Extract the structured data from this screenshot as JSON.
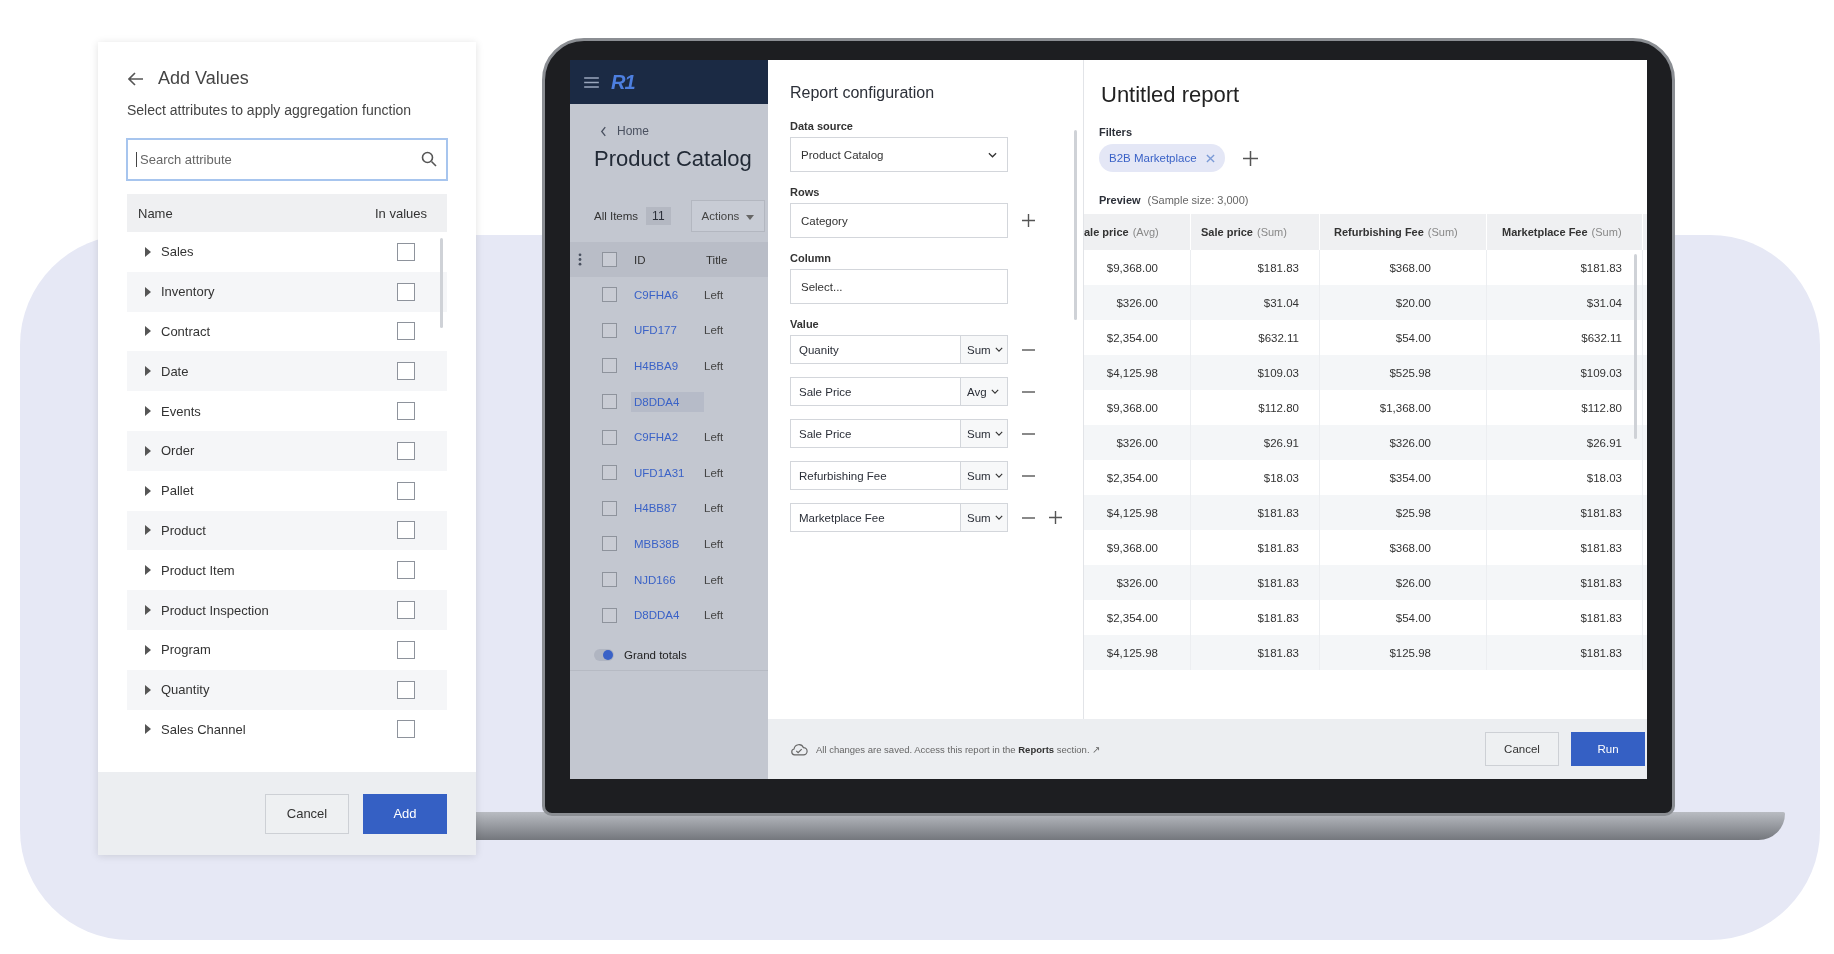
{
  "add_values_panel": {
    "title": "Add Values",
    "subtitle": "Select attributes to apply aggregation function",
    "search": {
      "placeholder": "Search attribute",
      "focused": true
    },
    "columns": [
      "Name",
      "In values"
    ],
    "attributes": [
      {
        "name": "Sales",
        "expanded": false,
        "checked": false
      },
      {
        "name": "Inventory",
        "expanded": false,
        "checked": false
      },
      {
        "name": "Contract",
        "expanded": false,
        "checked": false
      },
      {
        "name": "Date",
        "expanded": false,
        "checked": false
      },
      {
        "name": "Events",
        "expanded": false,
        "checked": false
      },
      {
        "name": "Order",
        "expanded": false,
        "checked": false
      },
      {
        "name": "Pallet",
        "expanded": false,
        "checked": false
      },
      {
        "name": "Product",
        "expanded": false,
        "checked": false
      },
      {
        "name": "Product Item",
        "expanded": false,
        "checked": false
      },
      {
        "name": "Product Inspection",
        "expanded": false,
        "checked": false
      },
      {
        "name": "Program",
        "expanded": false,
        "checked": false
      },
      {
        "name": "Quantity",
        "expanded": false,
        "checked": false
      },
      {
        "name": "Sales Channel",
        "expanded": false,
        "checked": false
      }
    ],
    "buttons": {
      "cancel": "Cancel",
      "add": "Add"
    }
  },
  "app": {
    "logo": "R1",
    "breadcrumb": "Home",
    "page_title": "Product Catalog",
    "view": {
      "label": "All Items",
      "count": "11"
    },
    "actions": "Actions",
    "table": {
      "all_checked": false,
      "columns": [
        "ID",
        "Title"
      ],
      "rows": [
        {
          "id": "C9FHA6",
          "title": "Left",
          "checked": false,
          "selected": false
        },
        {
          "id": "UFD177",
          "title": "Left",
          "checked": false,
          "selected": false
        },
        {
          "id": "H4BBA9",
          "title": "Left",
          "checked": false,
          "selected": false
        },
        {
          "id": "D8DDA4",
          "checked": false,
          "selected": true
        },
        {
          "id": "C9FHA2",
          "title": "Left",
          "checked": false,
          "selected": false
        },
        {
          "id": "UFD1A31",
          "title": "Left",
          "checked": false,
          "selected": false
        },
        {
          "id": "H4BB87",
          "title": "Left",
          "checked": false,
          "selected": false
        },
        {
          "id": "MBB38B",
          "title": "Left",
          "checked": false,
          "selected": false
        },
        {
          "id": "NJD166",
          "title": "Left",
          "checked": false,
          "selected": false
        },
        {
          "id": "D8DDA4",
          "title": "Left",
          "checked": false,
          "selected": false
        }
      ]
    },
    "grand_totals": {
      "label": "Grand totals",
      "on": true
    }
  },
  "report_configuration": {
    "title": "Report configuration",
    "data_source": {
      "label": "Data source",
      "value": "Product Catalog"
    },
    "rows": {
      "label": "Rows",
      "value": "Category"
    },
    "column": {
      "label": "Column",
      "placeholder": "Select..."
    },
    "value": {
      "label": "Value",
      "items": [
        {
          "attribute": "Quanity",
          "aggregation": "Sum",
          "show_add": false
        },
        {
          "attribute": "Sale Price",
          "aggregation": "Avg",
          "show_add": false
        },
        {
          "attribute": "Sale Price",
          "aggregation": "Sum",
          "show_add": false
        },
        {
          "attribute": "Refurbishing Fee",
          "aggregation": "Sum",
          "show_add": false
        },
        {
          "attribute": "Marketplace Fee",
          "aggregation": "Sum",
          "show_add": true
        }
      ]
    },
    "save_message": "All changes are saved. Access this report in the **Reports** section.",
    "save_link_icon": "↗"
  },
  "report": {
    "title": "Untitled report",
    "filters_label": "Filters",
    "filters": [
      {
        "label": "B2B Marketplace"
      }
    ],
    "preview_label": "Preview",
    "sample_size": "(Sample size: 3,000)",
    "columns": [
      {
        "name": "ale price",
        "aggregation": "(Avg)"
      },
      {
        "name": "Sale price",
        "aggregation": "(Sum)"
      },
      {
        "name": "Refurbishing Fee",
        "aggregation": "(Sum)"
      },
      {
        "name": "Marketplace Fee",
        "aggregation": "(Sum)"
      }
    ],
    "rows": [
      [
        "$9,368.00",
        "$181.83",
        "$368.00",
        "$181.83"
      ],
      [
        "$326.00",
        "$31.04",
        "$20.00",
        "$31.04"
      ],
      [
        "$2,354.00",
        "$632.11",
        "$54.00",
        "$632.11"
      ],
      [
        "$4,125.98",
        "$109.03",
        "$525.98",
        "$109.03"
      ],
      [
        "$9,368.00",
        "$112.80",
        "$1,368.00",
        "$112.80"
      ],
      [
        "$326.00",
        "$26.91",
        "$326.00",
        "$26.91"
      ],
      [
        "$2,354.00",
        "$18.03",
        "$354.00",
        "$18.03"
      ],
      [
        "$4,125.98",
        "$181.83",
        "$25.98",
        "$181.83"
      ],
      [
        "$9,368.00",
        "$181.83",
        "$368.00",
        "$181.83"
      ],
      [
        "$326.00",
        "$181.83",
        "$26.00",
        "$181.83"
      ],
      [
        "$2,354.00",
        "$181.83",
        "$54.00",
        "$181.83"
      ],
      [
        "$4,125.98",
        "$181.83",
        "$125.98",
        "$181.83"
      ]
    ],
    "buttons": {
      "cancel": "Cancel",
      "run": "Run"
    }
  }
}
